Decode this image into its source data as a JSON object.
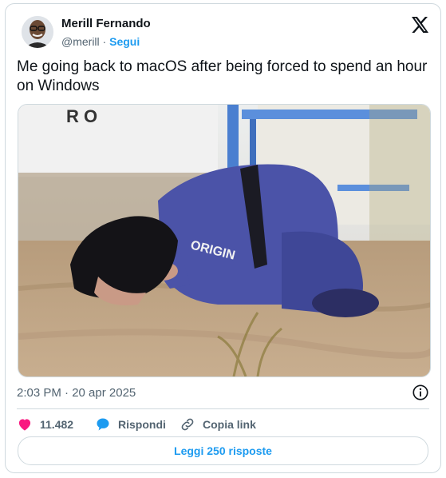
{
  "author": {
    "name": "Merill Fernando",
    "handle": "@merill",
    "separator": "·",
    "follow_label": "Segui"
  },
  "tweet": {
    "text": "Me going back to macOS after being forced to spend an hour on Windows",
    "timestamp": "2:03 PM · 20 apr 2025"
  },
  "media": {
    "sign_letters": "R O",
    "suit_logo": "ORIGIN"
  },
  "actions": {
    "likes": "11.482",
    "reply_label": "Rispondi",
    "copy_link_label": "Copia link",
    "read_replies_label": "Leggi 250 risposte"
  },
  "colors": {
    "accent": "#1d9bf0",
    "like": "#f91880",
    "muted": "#536471",
    "border": "#cfd9de"
  },
  "icons": [
    "x-logo-icon",
    "info-icon",
    "heart-icon",
    "reply-bubble-icon",
    "link-icon"
  ]
}
